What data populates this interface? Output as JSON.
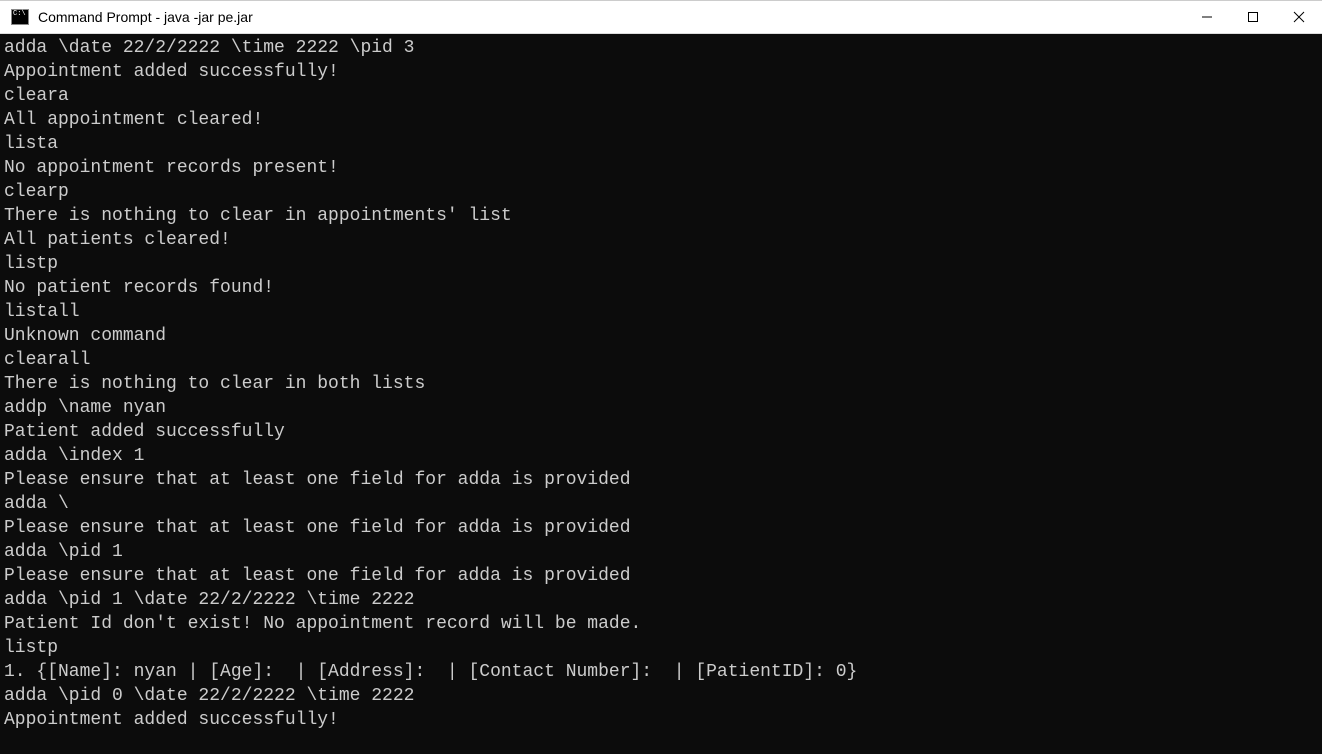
{
  "window": {
    "title": "Command Prompt - java  -jar pe.jar"
  },
  "terminal": {
    "lines": [
      "adda \\date 22/2/2222 \\time 2222 \\pid 3",
      "Appointment added successfully!",
      "cleara",
      "All appointment cleared!",
      "lista",
      "No appointment records present!",
      "clearp",
      "There is nothing to clear in appointments' list",
      "All patients cleared!",
      "listp",
      "No patient records found!",
      "listall",
      "Unknown command",
      "clearall",
      "There is nothing to clear in both lists",
      "addp \\name nyan",
      "Patient added successfully",
      "adda \\index 1",
      "Please ensure that at least one field for adda is provided",
      "adda \\",
      "Please ensure that at least one field for adda is provided",
      "adda \\pid 1",
      "Please ensure that at least one field for adda is provided",
      "adda \\pid 1 \\date 22/2/2222 \\time 2222",
      "Patient Id don't exist! No appointment record will be made.",
      "listp",
      "1. {[Name]: nyan | [Age]:  | [Address]:  | [Contact Number]:  | [PatientID]: 0}",
      "adda \\pid 0 \\date 22/2/2222 \\time 2222",
      "Appointment added successfully!"
    ]
  }
}
